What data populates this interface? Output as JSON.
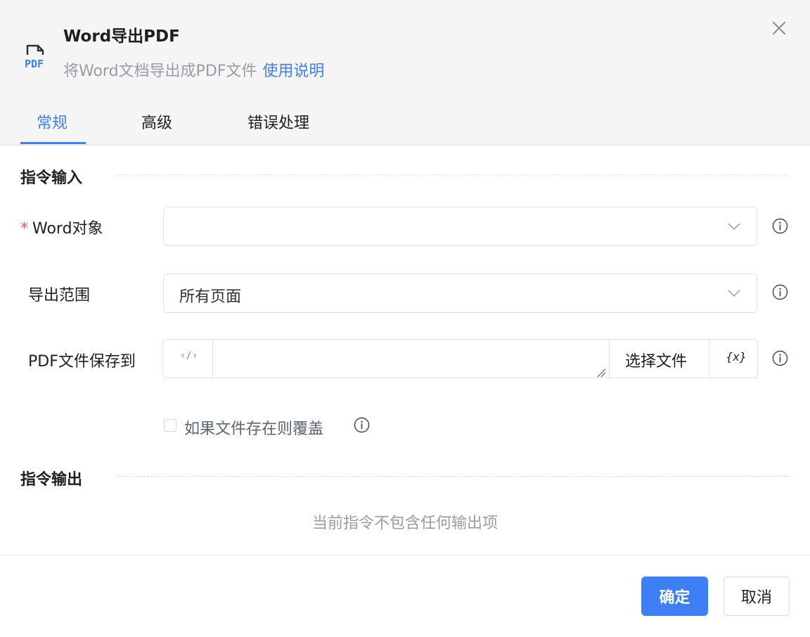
{
  "dialog": {
    "title": "Word导出PDF",
    "subtitle": "将Word文档导出成PDF文件",
    "help_link": "使用说明",
    "icon_text": "PDF"
  },
  "tabs": [
    {
      "label": "常规",
      "active": true
    },
    {
      "label": "高级",
      "active": false
    },
    {
      "label": "错误处理",
      "active": false
    }
  ],
  "input_section": {
    "title": "指令输入",
    "fields": {
      "word_object": {
        "required_mark": "*",
        "label": "Word对象",
        "value": ""
      },
      "export_range": {
        "label": "导出范围",
        "value": "所有页面"
      },
      "save_path": {
        "label": "PDF文件保存到",
        "value": "",
        "code_glyph": "‹/›",
        "choose_label": "选择文件",
        "var_glyph": "{x}"
      }
    },
    "overwrite": {
      "label": "如果文件存在则覆盖",
      "checked": false
    }
  },
  "output_section": {
    "title": "指令输出",
    "empty_text": "当前指令不包含任何输出项"
  },
  "footer": {
    "ok_label": "确定",
    "cancel_label": "取消"
  },
  "colors": {
    "accent": "#3d7ff5",
    "required": "#f25b5b",
    "header_bg": "#f5f5f6"
  }
}
